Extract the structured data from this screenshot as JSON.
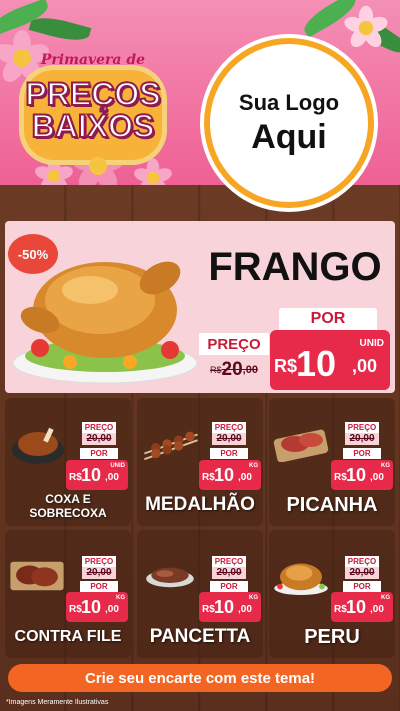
{
  "header": {
    "badge_subtitle": "Primavera de",
    "badge_line1": "PREÇOS",
    "badge_line2": "BAIXOS",
    "logo_line1": "Sua Logo",
    "logo_line2": "Aqui"
  },
  "hero": {
    "discount": "-50%",
    "name": "FRANGO",
    "preco_label": "PREÇO",
    "old_currency": "R$",
    "old_int": "20",
    "old_dec": ",00",
    "por_label": "POR",
    "currency": "R$",
    "price_int": "10",
    "price_dec": ",00",
    "unit": "UNID"
  },
  "items": [
    {
      "name": "COXA E\nSOBRECOXA",
      "preco_label": "PREÇO",
      "old": "20,00",
      "por_label": "POR",
      "currency": "R$",
      "price_int": "10",
      "price_dec": ",00",
      "unit": "UNID"
    },
    {
      "name": "MEDALHÃO",
      "preco_label": "PREÇO",
      "old": "20,00",
      "por_label": "POR",
      "currency": "R$",
      "price_int": "10",
      "price_dec": ",00",
      "unit": "KG"
    },
    {
      "name": "PICANHA",
      "preco_label": "PREÇO",
      "old": "20,00",
      "por_label": "POR",
      "currency": "R$",
      "price_int": "10",
      "price_dec": ",00",
      "unit": "KG"
    },
    {
      "name": "CONTRA FILE",
      "preco_label": "PREÇO",
      "old": "20,00",
      "por_label": "POR",
      "currency": "R$",
      "price_int": "10",
      "price_dec": ",00",
      "unit": "KG"
    },
    {
      "name": "PANCETTA",
      "preco_label": "PREÇO",
      "old": "20,00",
      "por_label": "POR",
      "currency": "R$",
      "price_int": "10",
      "price_dec": ",00",
      "unit": "KG"
    },
    {
      "name": "PERU",
      "preco_label": "PREÇO",
      "old": "20,00",
      "por_label": "POR",
      "currency": "R$",
      "price_int": "10",
      "price_dec": ",00",
      "unit": "KG"
    }
  ],
  "footer": {
    "cta": "Crie seu encarte com este tema!",
    "disclaimer": "*Imagens Meramente Ilustrativas"
  },
  "colors": {
    "pink_bg": "#ee5e92",
    "price_red": "#e7294a",
    "cta_orange": "#f26522",
    "wood": "#5a2f1d"
  }
}
